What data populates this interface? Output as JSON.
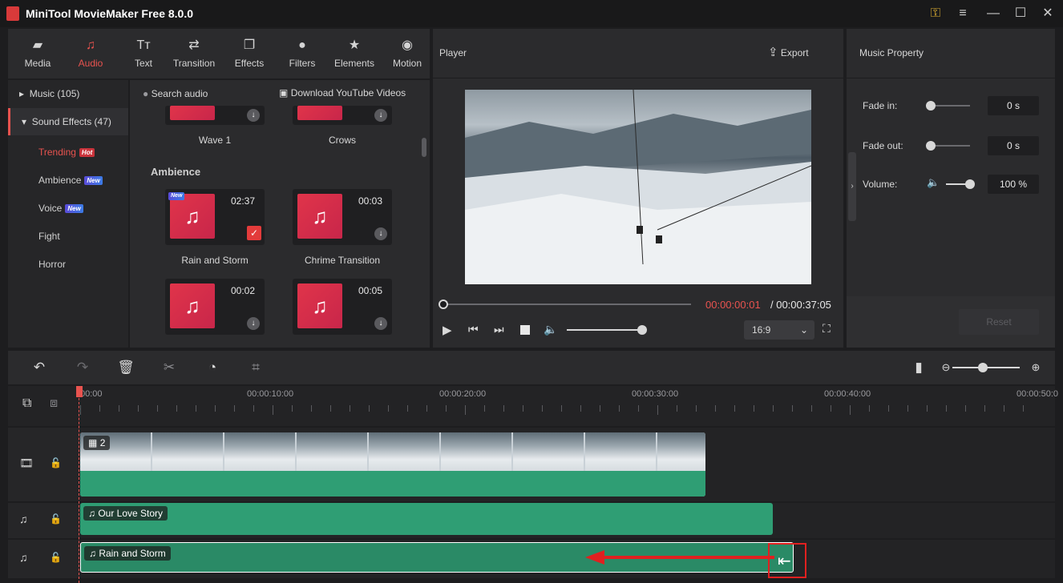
{
  "app": {
    "title": "MiniTool MovieMaker Free 8.0.0"
  },
  "window_controls": {
    "key": "key-icon",
    "menu": "≡",
    "minimize": "—",
    "maximize": "☐",
    "close": "✕"
  },
  "toolbar": [
    {
      "label": "Media",
      "icon": "folder-icon"
    },
    {
      "label": "Audio",
      "icon": "music-note-icon",
      "active": true
    },
    {
      "label": "Text",
      "icon": "text-icon"
    },
    {
      "label": "Transition",
      "icon": "transition-icon"
    },
    {
      "label": "Effects",
      "icon": "effects-icon"
    },
    {
      "label": "Filters",
      "icon": "filters-icon"
    },
    {
      "label": "Elements",
      "icon": "elements-icon"
    },
    {
      "label": "Motion",
      "icon": "motion-icon"
    }
  ],
  "categories": {
    "music": "Music (105)",
    "sound_effects": "Sound Effects (47)",
    "sub": [
      {
        "label": "Trending",
        "badge": "Hot"
      },
      {
        "label": "Ambience",
        "badge": "New"
      },
      {
        "label": "Voice",
        "badge": "New"
      },
      {
        "label": "Fight",
        "badge": ""
      },
      {
        "label": "Horror",
        "badge": ""
      }
    ]
  },
  "library": {
    "search": "Search audio",
    "youtube": "Download YouTube Videos",
    "top_names": [
      "Wave 1",
      "Crows"
    ],
    "section": "Ambience",
    "cards": [
      {
        "name": "Rain and Storm",
        "duration": "02:37",
        "new": "New",
        "checked": true
      },
      {
        "name": "Chrime Transition",
        "duration": "00:03"
      },
      {
        "name": "",
        "duration": "00:02"
      },
      {
        "name": "",
        "duration": "00:05"
      }
    ]
  },
  "player": {
    "title": "Player",
    "export": "Export",
    "current_time": "00:00:00:01",
    "total_time": "/ 00:00:37:05",
    "aspect": "16:9",
    "progress": 0.0,
    "volume": 1.0
  },
  "music_property": {
    "title": "Music Property",
    "fade_in_label": "Fade in:",
    "fade_in_value": "0 s",
    "fade_out_label": "Fade out:",
    "fade_out_value": "0 s",
    "volume_label": "Volume:",
    "volume_value": "100 %",
    "reset": "Reset"
  },
  "timeline": {
    "ruler_labels": [
      "00:00",
      "00:00:10:00",
      "00:00:20:00",
      "00:00:30:00",
      "00:00:40:00",
      "00:00:50:0"
    ],
    "video_clip_count": "2",
    "audio_clips": [
      "Our Love Story",
      "Rain and Storm"
    ]
  },
  "colors": {
    "accent": "#e8534f",
    "wave": "#2f9e74",
    "panel": "#2b2b2d"
  }
}
